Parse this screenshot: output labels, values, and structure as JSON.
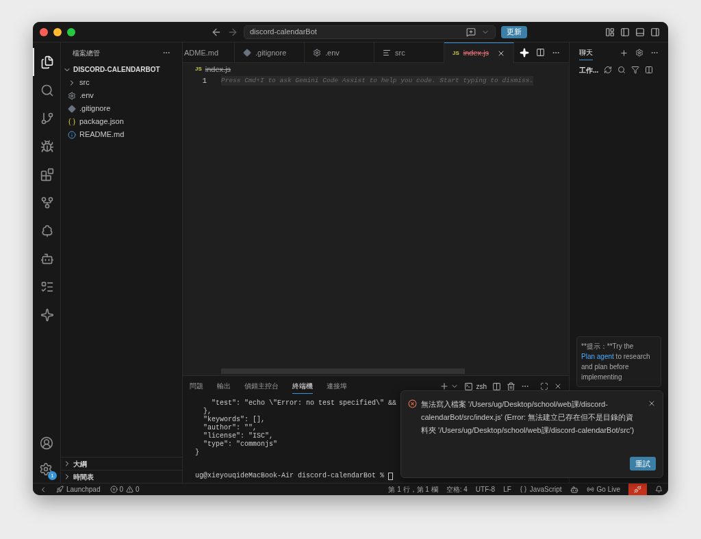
{
  "title_bar": {
    "search": "discord-calendarBot",
    "update_button": "更新"
  },
  "activity_bar": {
    "items": [
      {
        "kind": "files",
        "selected": true
      },
      {
        "kind": "search",
        "selected": false
      },
      {
        "kind": "scm",
        "selected": false
      },
      {
        "kind": "debug",
        "selected": false
      },
      {
        "kind": "extensions",
        "selected": false
      },
      {
        "kind": "graph",
        "selected": false
      },
      {
        "kind": "tree",
        "selected": false
      },
      {
        "kind": "bot",
        "selected": false
      },
      {
        "kind": "tasks",
        "selected": false
      },
      {
        "kind": "sparkle",
        "selected": false
      }
    ],
    "settings_badge": "1"
  },
  "explorer": {
    "title": "檔案總管",
    "root": {
      "label": "DISCORD-CALENDARBOT",
      "expanded": true,
      "children": [
        {
          "label": "src",
          "kind": "folder",
          "expanded": false
        },
        {
          "label": ".env",
          "kind": "gear"
        },
        {
          "label": ".gitignore",
          "kind": "diamond"
        },
        {
          "label": "package.json",
          "kind": "braces"
        },
        {
          "label": "README.md",
          "kind": "info"
        }
      ]
    },
    "sections": [
      {
        "label": "大綱",
        "expanded": false
      },
      {
        "label": "時間表",
        "expanded": false
      }
    ]
  },
  "editor_tabs": [
    {
      "label": "ADME.md",
      "kind": "plain",
      "selected": false,
      "deleted": false
    },
    {
      "label": ".gitignore",
      "kind": "diamond",
      "selected": false,
      "deleted": false
    },
    {
      "label": ".env",
      "kind": "gear",
      "selected": false,
      "deleted": false
    },
    {
      "label": "src",
      "kind": "lines",
      "selected": false,
      "deleted": false
    },
    {
      "label": "index.js",
      "kind": "js",
      "badge": "JS",
      "selected": true,
      "deleted": true
    }
  ],
  "breadcrumb": {
    "badge": "JS",
    "label": "index.js",
    "deleted": true
  },
  "editor": {
    "lines": [
      {
        "number": "1",
        "ghost_text": "Press Cmd+I to ask Gemini Code Assist to help you code. Start typing to dismiss."
      }
    ]
  },
  "panel": {
    "tabs": [
      {
        "label": "問題",
        "selected": false
      },
      {
        "label": "輸出",
        "selected": false
      },
      {
        "label": "偵錯主控台",
        "selected": false
      },
      {
        "label": "終端機",
        "selected": true
      },
      {
        "label": "連接埠",
        "selected": false
      }
    ],
    "shell": "zsh",
    "terminal_lines": [
      "    \"test\": \"echo \\\"Error: no test specified\\\" &&",
      "  },",
      "  \"keywords\": [],",
      "  \"author\": \"\",",
      "  \"license\": \"ISC\",",
      "  \"type\": \"commonjs\"",
      "}"
    ],
    "prompt": "ug@xieyouqideMacBook-Air discord-calendarBot % "
  },
  "chat": {
    "tabs": [
      {
        "label": "聊天",
        "selected": true
      }
    ],
    "section": "工作...",
    "tip": {
      "before": "**提示：**Try the ",
      "link": "Plan agent",
      "after": " to research and plan before implementing"
    }
  },
  "notification": {
    "message": "無法寫入檔案 '/Users/ug/Desktop/school/web課/discord-calendarBot/src/index.js' (Error: 無法建立已存在但不是目錄的資料夾 '/Users/ug/Desktop/school/web課/discord-calendarBot/src')",
    "button": "重試"
  },
  "status_bar": {
    "launchpad": "Launchpad",
    "errors": "0",
    "warnings": "0",
    "position": "第 1 行，第 1 欄",
    "indent": "空格: 4",
    "encoding": "UTF-8",
    "eol": "LF",
    "language": "JavaScript",
    "live": "Go Live"
  }
}
